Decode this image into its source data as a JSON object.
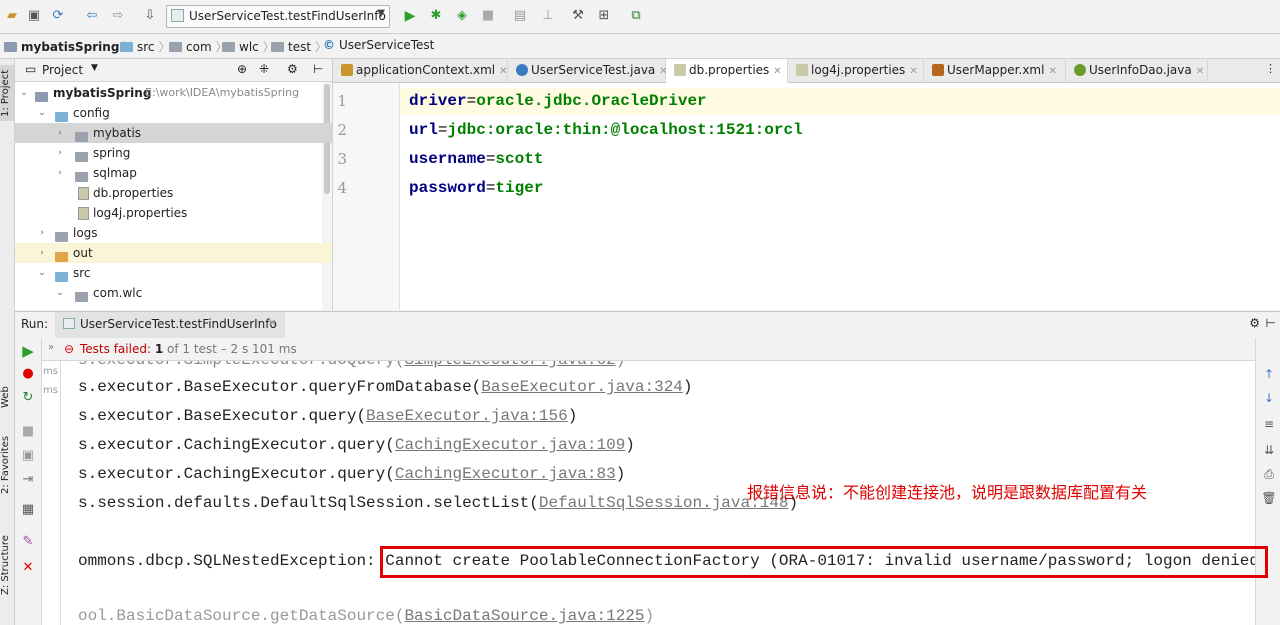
{
  "toolbar": {
    "run_config_label": "UserServiceTest.testFindUserInfo"
  },
  "breadcrumb": [
    "mybatisSpring",
    "src",
    "com",
    "wlc",
    "test",
    "UserServiceTest"
  ],
  "left_strip": {
    "project_tab": "1: Project",
    "web_tab": "Web",
    "favorites_tab": "2: Favorites",
    "structure_tab": "Z: Structure"
  },
  "project_panel": {
    "title": "Project",
    "tree": [
      {
        "label": "mybatisSpring",
        "path": "E:\\work\\IDEA\\mybatisSpring"
      },
      {
        "label": "config"
      },
      {
        "label": "mybatis"
      },
      {
        "label": "spring"
      },
      {
        "label": "sqlmap"
      },
      {
        "label": "db.properties"
      },
      {
        "label": "log4j.properties"
      },
      {
        "label": "logs"
      },
      {
        "label": "out"
      },
      {
        "label": "src"
      },
      {
        "label": "com.wlc"
      }
    ]
  },
  "editor": {
    "tabs": [
      {
        "label": "applicationContext.xml"
      },
      {
        "label": "UserServiceTest.java"
      },
      {
        "label": "db.properties"
      },
      {
        "label": "log4j.properties"
      },
      {
        "label": "UserMapper.xml"
      },
      {
        "label": "UserInfoDao.java"
      }
    ],
    "line_numbers": [
      "1",
      "2",
      "3",
      "4"
    ],
    "lines": [
      {
        "key": "driver",
        "eq": "=",
        "value": "oracle.jdbc.OracleDriver"
      },
      {
        "key": "url",
        "eq": "=",
        "value": "jdbc:oracle:thin:@localhost:1521:orcl"
      },
      {
        "key": "username",
        "eq": "=",
        "value": "scott"
      },
      {
        "key": "password",
        "eq": "=",
        "value": "tiger"
      }
    ]
  },
  "run": {
    "label": "Run:",
    "tab_label": "UserServiceTest.testFindUserInfo",
    "status_prefix": "Tests failed:",
    "status_count": "1",
    "status_rest": "of 1 test – 2 s 101 ms",
    "tree_items": [
      "ms",
      "ms"
    ],
    "console": [
      {
        "text": "s.executor.BaseExecutor.queryFromDatabase(",
        "link": "BaseExecutor.java:324",
        "end": ")"
      },
      {
        "text": "s.executor.BaseExecutor.query(",
        "link": "BaseExecutor.java:156",
        "end": ")"
      },
      {
        "text": "s.executor.CachingExecutor.query(",
        "link": "CachingExecutor.java:109",
        "end": ")"
      },
      {
        "text": "s.executor.CachingExecutor.query(",
        "link": "CachingExecutor.java:83",
        "end": ")"
      },
      {
        "text": "s.session.defaults.DefaultSqlSession.selectList(",
        "link": "DefaultSqlSession.java:148",
        "end": ")"
      }
    ],
    "exception_prefix": "ommons.dbcp.SQLNestedException: ",
    "exception_message": "Cannot create PoolableConnectionFactory (ORA-01017: invalid username/password; logon denied"
  },
  "annotation": "报错信息说：不能创建连接池，说明是跟数据库配置有关",
  "colors": {
    "run_green": "#3c9a3c",
    "fail_red": "#e00000",
    "key_blue": "#000080",
    "value_green": "#008000"
  }
}
